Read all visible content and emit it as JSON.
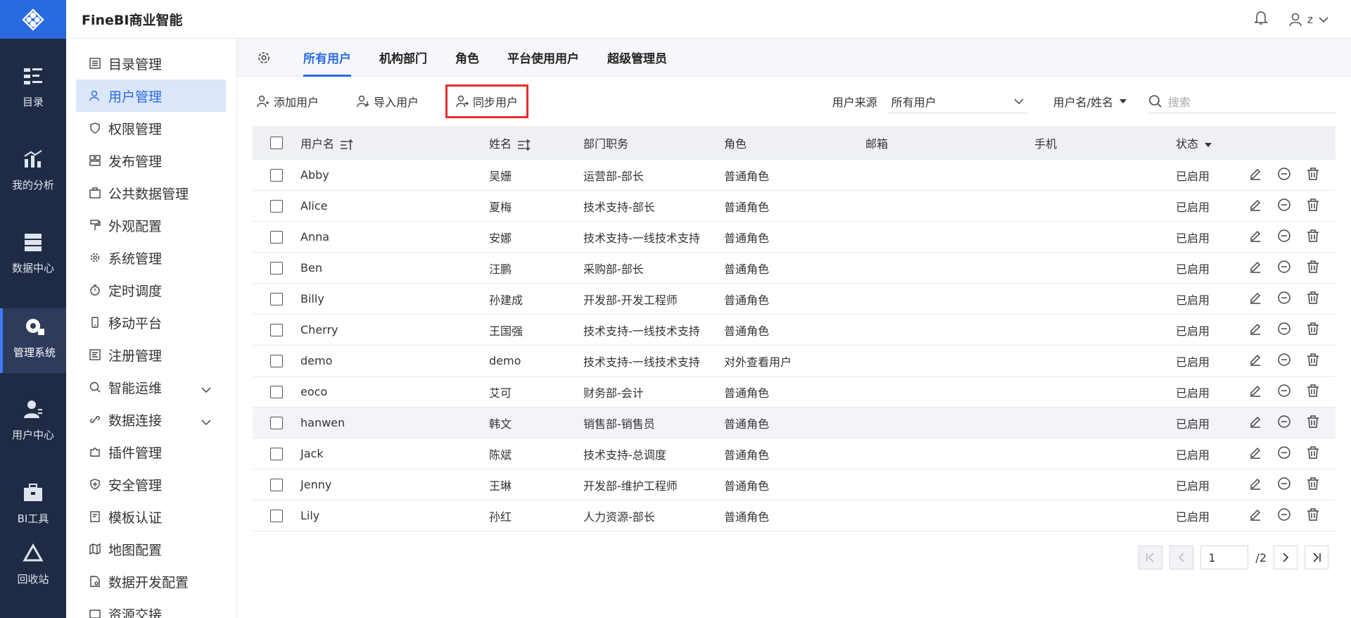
{
  "app": {
    "title": "FineBI商业智能",
    "user_initial": "z"
  },
  "nav": {
    "items": [
      {
        "label": "目录",
        "icon": "catalog-icon"
      },
      {
        "label": "我的分析",
        "icon": "analysis-chart-icon"
      },
      {
        "label": "数据中心",
        "icon": "data-center-icon"
      },
      {
        "label": "管理系统",
        "icon": "management-gear-icon"
      },
      {
        "label": "用户中心",
        "icon": "user-center-icon"
      },
      {
        "label": "BI工具",
        "icon": "toolbox-icon"
      },
      {
        "label": "回收站",
        "icon": "recycle-icon"
      }
    ]
  },
  "sidebar": {
    "items": [
      {
        "label": "目录管理"
      },
      {
        "label": "用户管理"
      },
      {
        "label": "权限管理"
      },
      {
        "label": "发布管理"
      },
      {
        "label": "公共数据管理"
      },
      {
        "label": "外观配置"
      },
      {
        "label": "系统管理"
      },
      {
        "label": "定时调度"
      },
      {
        "label": "移动平台"
      },
      {
        "label": "注册管理"
      },
      {
        "label": "智能运维"
      },
      {
        "label": "数据连接"
      },
      {
        "label": "插件管理"
      },
      {
        "label": "安全管理"
      },
      {
        "label": "模板认证"
      },
      {
        "label": "地图配置"
      },
      {
        "label": "数据开发配置"
      },
      {
        "label": "资源交接"
      }
    ]
  },
  "tabs": [
    "所有用户",
    "机构部门",
    "角色",
    "平台使用用户",
    "超级管理员"
  ],
  "toolbar": {
    "add_user": "添加用户",
    "import_user": "导入用户",
    "sync_user": "同步用户",
    "source_label": "用户来源",
    "source_value": "所有用户",
    "field_select": "用户名/姓名",
    "search_placeholder": "搜索"
  },
  "table": {
    "headers": {
      "username": "用户名",
      "name": "姓名",
      "dept": "部门职务",
      "role": "角色",
      "email": "邮箱",
      "phone": "手机",
      "status": "状态"
    },
    "rows": [
      {
        "username": "Abby",
        "name": "吴姗",
        "dept": "运营部-部长",
        "role": "普通角色",
        "email": "",
        "phone": "",
        "status": "已启用"
      },
      {
        "username": "Alice",
        "name": "夏梅",
        "dept": "技术支持-部长",
        "role": "普通角色",
        "email": "",
        "phone": "",
        "status": "已启用"
      },
      {
        "username": "Anna",
        "name": "安娜",
        "dept": "技术支持-一线技术支持",
        "role": "普通角色",
        "email": "",
        "phone": "",
        "status": "已启用"
      },
      {
        "username": "Ben",
        "name": "汪鹏",
        "dept": "采购部-部长",
        "role": "普通角色",
        "email": "",
        "phone": "",
        "status": "已启用"
      },
      {
        "username": "Billy",
        "name": "孙建成",
        "dept": "开发部-开发工程师",
        "role": "普通角色",
        "email": "",
        "phone": "",
        "status": "已启用"
      },
      {
        "username": "Cherry",
        "name": "王国强",
        "dept": "技术支持-一线技术支持",
        "role": "普通角色",
        "email": "",
        "phone": "",
        "status": "已启用"
      },
      {
        "username": "demo",
        "name": "demo",
        "dept": "技术支持-一线技术支持",
        "role": "对外查看用户",
        "email": "",
        "phone": "",
        "status": "已启用"
      },
      {
        "username": "eoco",
        "name": "艾可",
        "dept": "财务部-会计",
        "role": "普通角色",
        "email": "",
        "phone": "",
        "status": "已启用"
      },
      {
        "username": "hanwen",
        "name": "韩文",
        "dept": "销售部-销售员",
        "role": "普通角色",
        "email": "",
        "phone": "",
        "status": "已启用"
      },
      {
        "username": "Jack",
        "name": "陈斌",
        "dept": "技术支持-总调度",
        "role": "普通角色",
        "email": "",
        "phone": "",
        "status": "已启用"
      },
      {
        "username": "Jenny",
        "name": "王琳",
        "dept": "开发部-维护工程师",
        "role": "普通角色",
        "email": "",
        "phone": "",
        "status": "已启用"
      },
      {
        "username": "Lily",
        "name": "孙红",
        "dept": "人力资源-部长",
        "role": "普通角色",
        "email": "",
        "phone": "",
        "status": "已启用"
      }
    ]
  },
  "pager": {
    "current": "1",
    "total": "/2"
  },
  "colors": {
    "accent": "#2a6ae0",
    "nav_bg": "#1f2a44",
    "highlight_border": "#e4302b"
  }
}
